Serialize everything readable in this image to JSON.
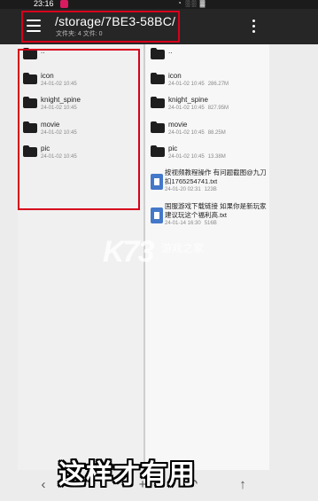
{
  "statusbar": {
    "time": "23:16",
    "system": "◔ ░░ ▓"
  },
  "appbar": {
    "path": "/storage/7BE3-58BC/",
    "counts": "文件夹: 4  文件: 0"
  },
  "left_pane": {
    "parent_label": "..",
    "folders": [
      {
        "name": "icon",
        "date": "24-01-02 10:45",
        "size": ""
      },
      {
        "name": "knight_spine",
        "date": "24-01-02 10:45",
        "size": ""
      },
      {
        "name": "movie",
        "date": "24-01-02 10:45",
        "size": ""
      },
      {
        "name": "pic",
        "date": "24-01-02 10:45",
        "size": ""
      }
    ]
  },
  "right_pane": {
    "parent_label": "..",
    "folders": [
      {
        "name": "icon",
        "date": "24-01-02 10:45",
        "size": "286.27M"
      },
      {
        "name": "knight_spine",
        "date": "24-01-02 10:45",
        "size": "827.95M"
      },
      {
        "name": "movie",
        "date": "24-01-02 10:45",
        "size": "88.25M"
      },
      {
        "name": "pic",
        "date": "24-01-02 10:45",
        "size": "13.38M"
      }
    ],
    "files": [
      {
        "name": "按视频教程操作 有问题截图@九刀扣1765254741.txt",
        "date": "24-01-20 02:31",
        "size": "123B"
      },
      {
        "name": "国服游戏下载链接  如果你是新玩家建议玩这个福利高.txt",
        "date": "24-01-14 16:30",
        "size": "516B"
      }
    ]
  },
  "watermark": {
    "logo": "K73",
    "text": "游戏之家"
  },
  "caption": "这样才有用",
  "icons": {
    "menu": "menu-icon",
    "more": "more-vert-icon",
    "folder": "folder-icon",
    "file": "text-file-icon",
    "back": "‹",
    "add": "+",
    "undo": "↶",
    "up": "↑"
  },
  "colors": {
    "highlight": "#d6001c",
    "appbar": "#262626",
    "file_icon": "#4478c9"
  }
}
